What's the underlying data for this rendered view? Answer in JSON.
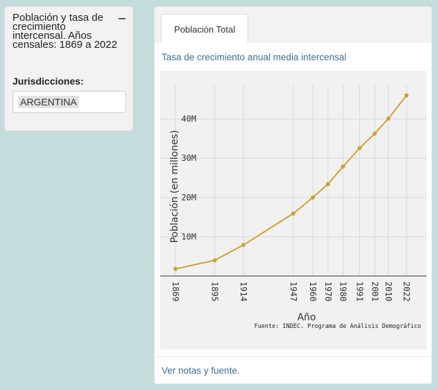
{
  "sidebar": {
    "title": "Población y tasa de crecimiento intercensal. Años censales: 1869 a 2022",
    "collapse_icon": "minus-icon",
    "jurisdiction_label": "Jurisdicciones:",
    "jurisdiction_selected": "ARGENTINA"
  },
  "main": {
    "tabs": [
      {
        "label": "Población Total",
        "active": true
      }
    ],
    "subtitle": "Tasa de crecimiento anual media intercensal",
    "footer_link": "Ver notas y fuente."
  },
  "colors": {
    "line": "#d0a130",
    "background": "#c5dcdd",
    "link": "#3f6e96"
  },
  "chart_data": {
    "type": "line",
    "xlabel": "Año",
    "ylabel": "Población (en millones)",
    "source": "Fuente: INDEC. Programa de Análisis Demográfico",
    "x": [
      1869,
      1895,
      1914,
      1947,
      1960,
      1970,
      1980,
      1991,
      2001,
      2010,
      2022
    ],
    "x_tick_labels": [
      "1869",
      "1895",
      "1914",
      "1947",
      "1960",
      "1970",
      "1980",
      "1991",
      "2001",
      "2010",
      "2022"
    ],
    "series": [
      {
        "values": [
          1.8,
          4.0,
          7.9,
          15.9,
          20.0,
          23.4,
          27.9,
          32.6,
          36.3,
          40.1,
          46.0
        ]
      }
    ],
    "y_ticks": [
      10,
      20,
      30,
      40
    ],
    "y_tick_labels": [
      "10M",
      "20M",
      "30M",
      "40M"
    ],
    "ylim": [
      0,
      48
    ],
    "xlim": [
      1869,
      2022
    ],
    "grid": true
  }
}
